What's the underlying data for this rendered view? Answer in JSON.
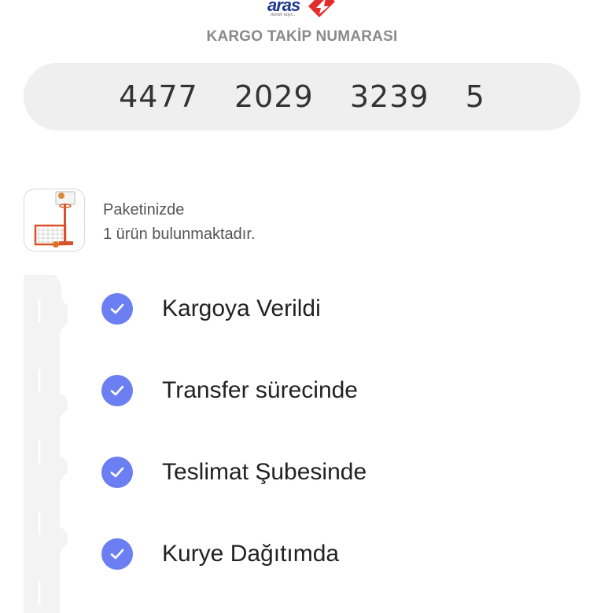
{
  "brand": {
    "logo_text": "aras",
    "tagline": "özenle taşır...",
    "accent_color": "#e32c2c",
    "brand_blue": "#1f3a8f"
  },
  "tracking": {
    "label": "KARGO TAKİP NUMARASI",
    "number": "4477  2029  3239  5"
  },
  "package": {
    "line1": "Paketinizde",
    "line2": "1 ürün bulunmaktadır.",
    "thumbnail_icon": "basketball-hoop-toy-image"
  },
  "timeline": {
    "check_color": "#6b7ff2",
    "steps": [
      {
        "label": "Kargoya Verildi",
        "status": "done",
        "icon": "check-icon"
      },
      {
        "label": "Transfer sürecinde",
        "status": "done",
        "icon": "check-icon"
      },
      {
        "label": "Teslimat Şubesinde",
        "status": "done",
        "icon": "check-icon"
      },
      {
        "label": "Kurye Dağıtımda",
        "status": "done",
        "icon": "check-icon"
      }
    ]
  }
}
